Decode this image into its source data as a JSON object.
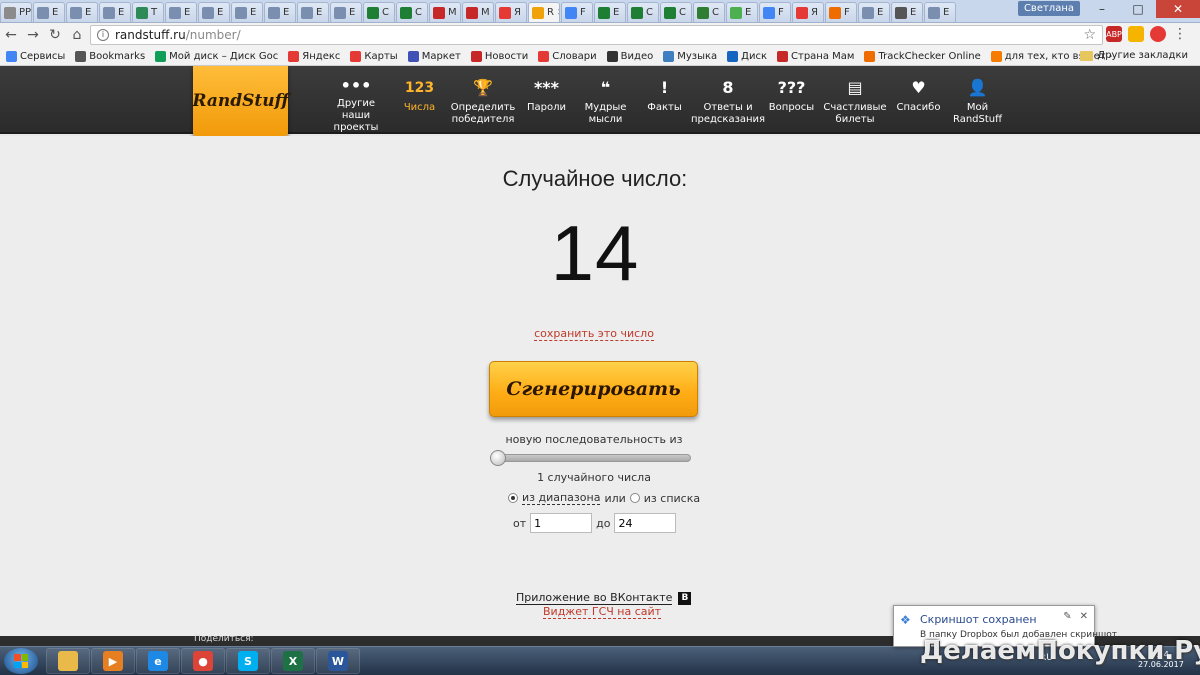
{
  "browser": {
    "tabs": [
      {
        "label": "РР",
        "color": "#8b8b8b"
      },
      {
        "label": "E",
        "color": "#7a8fb0"
      },
      {
        "label": "E",
        "color": "#7a8fb0"
      },
      {
        "label": "E",
        "color": "#7a8fb0"
      },
      {
        "label": "T",
        "color": "#2e8b57"
      },
      {
        "label": "E",
        "color": "#7a8fb0"
      },
      {
        "label": "E",
        "color": "#7a8fb0"
      },
      {
        "label": "E",
        "color": "#7a8fb0"
      },
      {
        "label": "E",
        "color": "#7a8fb0"
      },
      {
        "label": "E",
        "color": "#7a8fb0"
      },
      {
        "label": "E",
        "color": "#7a8fb0"
      },
      {
        "label": "C",
        "color": "#1e7e34"
      },
      {
        "label": "C",
        "color": "#1e7e34"
      },
      {
        "label": "M",
        "color": "#c62828"
      },
      {
        "label": "M",
        "color": "#c62828"
      },
      {
        "label": "Я",
        "color": "#e53935"
      },
      {
        "label": "R",
        "color": "#f0a20b"
      },
      {
        "label": "F",
        "color": "#4285f4"
      },
      {
        "label": "E",
        "color": "#1e7e34"
      },
      {
        "label": "C",
        "color": "#1e7e34"
      },
      {
        "label": "C",
        "color": "#1e7e34"
      },
      {
        "label": "C",
        "color": "#2e7d32"
      },
      {
        "label": "E",
        "color": "#4caf50"
      },
      {
        "label": "F",
        "color": "#4285f4"
      },
      {
        "label": "Я",
        "color": "#e53935"
      },
      {
        "label": "F",
        "color": "#ef6c00"
      },
      {
        "label": "E",
        "color": "#7a8fb0"
      },
      {
        "label": "E",
        "color": "#555555"
      },
      {
        "label": "E",
        "color": "#7a8fb0"
      }
    ],
    "active_tab_index": 16,
    "user_name": "Светлана",
    "url_host": "randstuff.ru",
    "url_path": "/number/",
    "bookmarks": [
      {
        "label": "Сервисы",
        "color": "#4285f4"
      },
      {
        "label": "Bookmarks",
        "color": "#555555"
      },
      {
        "label": "Мой диск – Диск Goc",
        "color": "#0f9d58"
      },
      {
        "label": "Яндекс",
        "color": "#e53935"
      },
      {
        "label": "Карты",
        "color": "#e53935"
      },
      {
        "label": "Маркет",
        "color": "#3f51b5"
      },
      {
        "label": "Новости",
        "color": "#c62828"
      },
      {
        "label": "Словари",
        "color": "#e53935"
      },
      {
        "label": "Видео",
        "color": "#333333"
      },
      {
        "label": "Музыка",
        "color": "#3f7fbf"
      },
      {
        "label": "Диск",
        "color": "#1565c0"
      },
      {
        "label": "Страна Мам",
        "color": "#c62828"
      },
      {
        "label": "TrackChecker Online",
        "color": "#ef6c00"
      },
      {
        "label": "для тех, кто вяжет -",
        "color": "#f57c00"
      }
    ],
    "other_bookmarks": "Другие закладки"
  },
  "site": {
    "logo": "RandStuff",
    "menu": [
      {
        "label": "Другие наши проекты",
        "icon": "•••",
        "name": "more-projects"
      },
      {
        "label": "Числа",
        "icon": "123",
        "name": "numbers",
        "active": true
      },
      {
        "label": "Определить победителя",
        "icon": "🏆",
        "name": "winner"
      },
      {
        "label": "Пароли",
        "icon": "***",
        "name": "passwords"
      },
      {
        "label": "Мудрые мысли",
        "icon": "❝",
        "name": "wise-thoughts"
      },
      {
        "label": "Факты",
        "icon": "!",
        "name": "facts"
      },
      {
        "label": "Ответы и предсказания",
        "icon": "8",
        "name": "answers"
      },
      {
        "label": "Вопросы",
        "icon": "???",
        "name": "questions"
      },
      {
        "label": "Счастливые билеты",
        "icon": "▤",
        "name": "lucky-tickets"
      },
      {
        "label": "Спасибо",
        "icon": "♥",
        "name": "thanks"
      },
      {
        "label": "Мой RandStuff",
        "icon": "👤",
        "name": "my-randstuff"
      }
    ]
  },
  "main": {
    "title": "Случайное число:",
    "number": "14",
    "save_link": "сохранить это число",
    "generate_button": "Сгенерировать",
    "sequence_label": "новую последовательность из",
    "slider_value": 1,
    "slider_max": 100,
    "count_label": "1 случайного числа",
    "mode_range": "из диапазона",
    "mode_or": "или",
    "mode_list": "из списка",
    "from_label": "от",
    "from_value": "1",
    "to_label": "до",
    "to_value": "24",
    "vk_app": "Приложение во ВКонтакте",
    "vk_badge": "В",
    "widget_link": "Виджет ГСЧ на сайт",
    "share_label": "Поделиться:"
  },
  "notification": {
    "title": "Скриншот сохранен",
    "body": "В папку Dropbox был добавлен скриншот."
  },
  "taskbar": {
    "apps": [
      {
        "name": "explorer",
        "color": "#e9b949",
        "glyph": ""
      },
      {
        "name": "media-player",
        "color": "#e67e22",
        "glyph": "▶"
      },
      {
        "name": "internet-explorer",
        "color": "#1e88e5",
        "glyph": "e"
      },
      {
        "name": "chrome",
        "color": "#db4437",
        "glyph": "●"
      },
      {
        "name": "skype",
        "color": "#00aff0",
        "glyph": "S"
      },
      {
        "name": "excel",
        "color": "#1e7145",
        "glyph": "X"
      },
      {
        "name": "word",
        "color": "#2b579a",
        "glyph": "W"
      }
    ],
    "lang": "RU",
    "time": ":54",
    "date": "27.06.2017"
  },
  "watermark": "ДелаемПокупки.Ру",
  "colors": {
    "accent": "#ffae17",
    "link_red": "#c0392b",
    "header_dark": "#333333"
  }
}
